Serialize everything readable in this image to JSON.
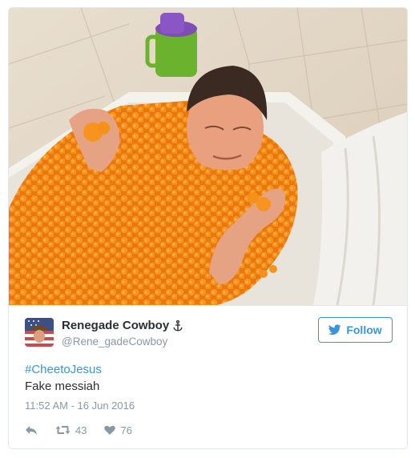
{
  "tweet": {
    "author": {
      "name": "Renegade Cowboy",
      "handle": "@Rene_gadeCowboy",
      "verified_symbol": "anchor-icon"
    },
    "follow_label": "Follow",
    "hashtag": "#CheetoJesus",
    "text": "Fake messiah",
    "timestamp": "11:52 AM - 16 Jun 2016",
    "retweets": "43",
    "likes": "76"
  },
  "icons": [
    "reply-icon",
    "retweet-icon",
    "heart-icon",
    "twitter-bird-icon",
    "anchor-icon"
  ],
  "colors": {
    "link": "#3b94d9",
    "text": "#292f33",
    "muted": "#8899a6",
    "border": "#e1e8ed",
    "cheese": "#f2881a"
  }
}
